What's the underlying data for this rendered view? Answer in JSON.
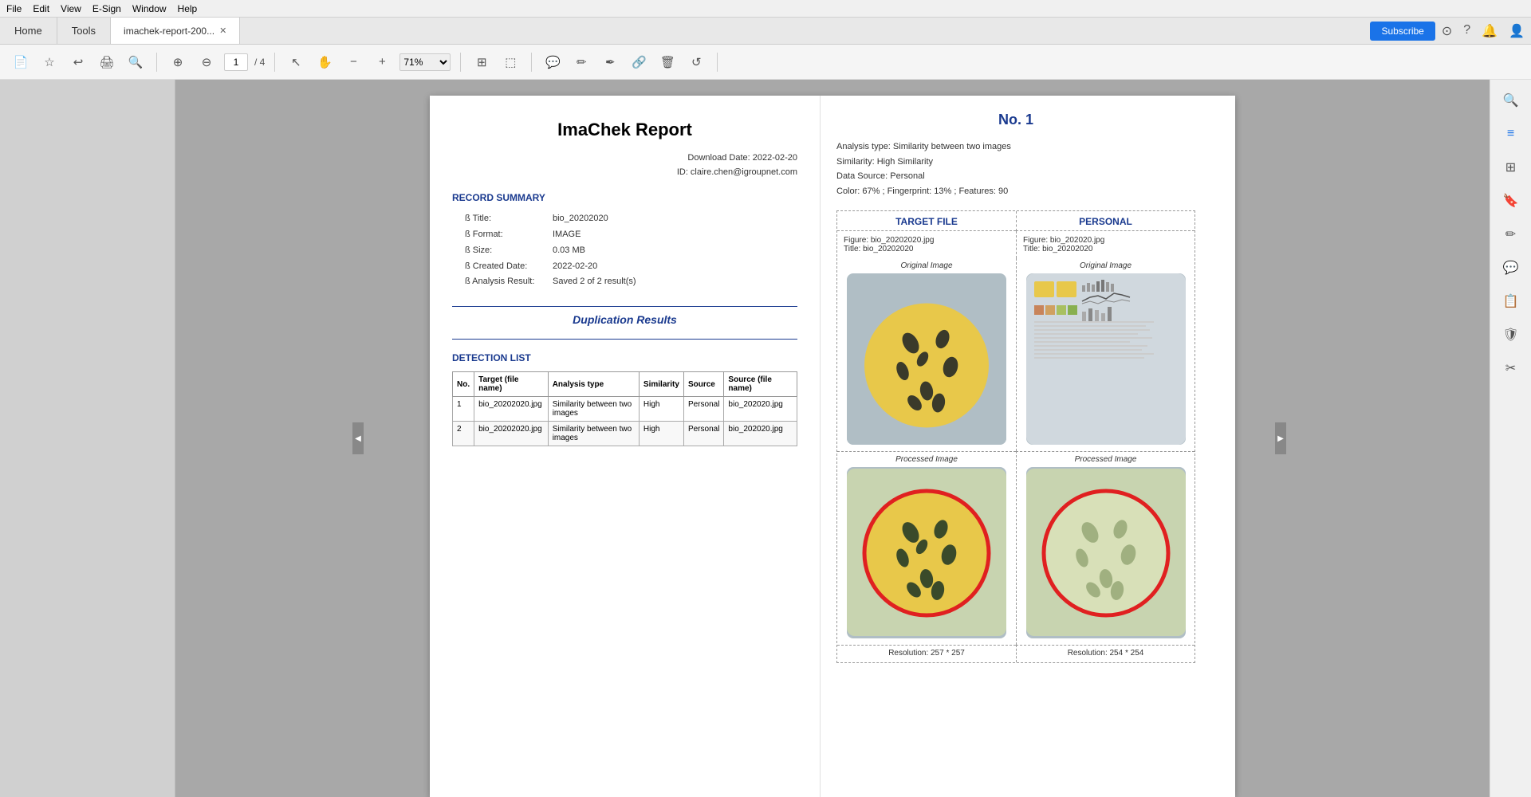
{
  "menu": {
    "items": [
      "File",
      "Edit",
      "View",
      "E-Sign",
      "Window",
      "Help"
    ]
  },
  "tabs": {
    "home": "Home",
    "tools": "Tools",
    "file": "imachek-report-200...",
    "subscribe": "Subscribe"
  },
  "toolbar": {
    "page_current": "1",
    "page_total": "/ 4",
    "zoom": "71%"
  },
  "left_page": {
    "title": "ImaChek Report",
    "download_date": "Download Date: 2022-02-20",
    "id": "ID: claire.chen@igroupnet.com",
    "record_summary": "RECORD SUMMARY",
    "fields": {
      "title_label": "ß Title:",
      "title_value": "bio_20202020",
      "format_label": "ß Format:",
      "format_value": "IMAGE",
      "size_label": "ß Size:",
      "size_value": "0.03 MB",
      "created_label": "ß Created Date:",
      "created_value": "2022-02-20",
      "analysis_label": "ß Analysis Result:",
      "analysis_value": "Saved 2 of 2 result(s)"
    },
    "duplication_results": "Duplication Results",
    "detection_list": "DETECTION LIST",
    "table": {
      "headers": [
        "No.",
        "Target (file name)",
        "Analysis type",
        "Similarity",
        "Source",
        "Source (file name)"
      ],
      "rows": [
        {
          "no": "1",
          "target": "bio_20202020.jpg",
          "analysis_type": "Similarity between two images",
          "similarity": "High",
          "source": "Personal",
          "source_file": "bio_202020.jpg"
        },
        {
          "no": "2",
          "target": "bio_20202020.jpg",
          "analysis_type": "Similarity between two images",
          "similarity": "High",
          "source": "Personal",
          "source_file": "bio_202020.jpg"
        }
      ]
    }
  },
  "right_page": {
    "number": "No. 1",
    "analysis_type": "Analysis type: Similarity between two images",
    "similarity": "Similarity: High Similarity",
    "data_source": "Data Source: Personal",
    "color_fingerprint": "Color: 67% ; Fingerprint: 13% ; Features: 90",
    "target_header": "TARGET FILE",
    "personal_header": "PERSONAL",
    "target_figure": "Figure: bio_20202020.jpg",
    "target_title": "Title: bio_20202020",
    "personal_figure": "Figure: bio_202020.jpg",
    "personal_title": "Title: bio_20202020",
    "original_label": "Original Image",
    "processed_label": "Processed Image",
    "resolution_left": "Resolution: 257 * 257",
    "resolution_right": "Resolution: 254 * 254"
  }
}
